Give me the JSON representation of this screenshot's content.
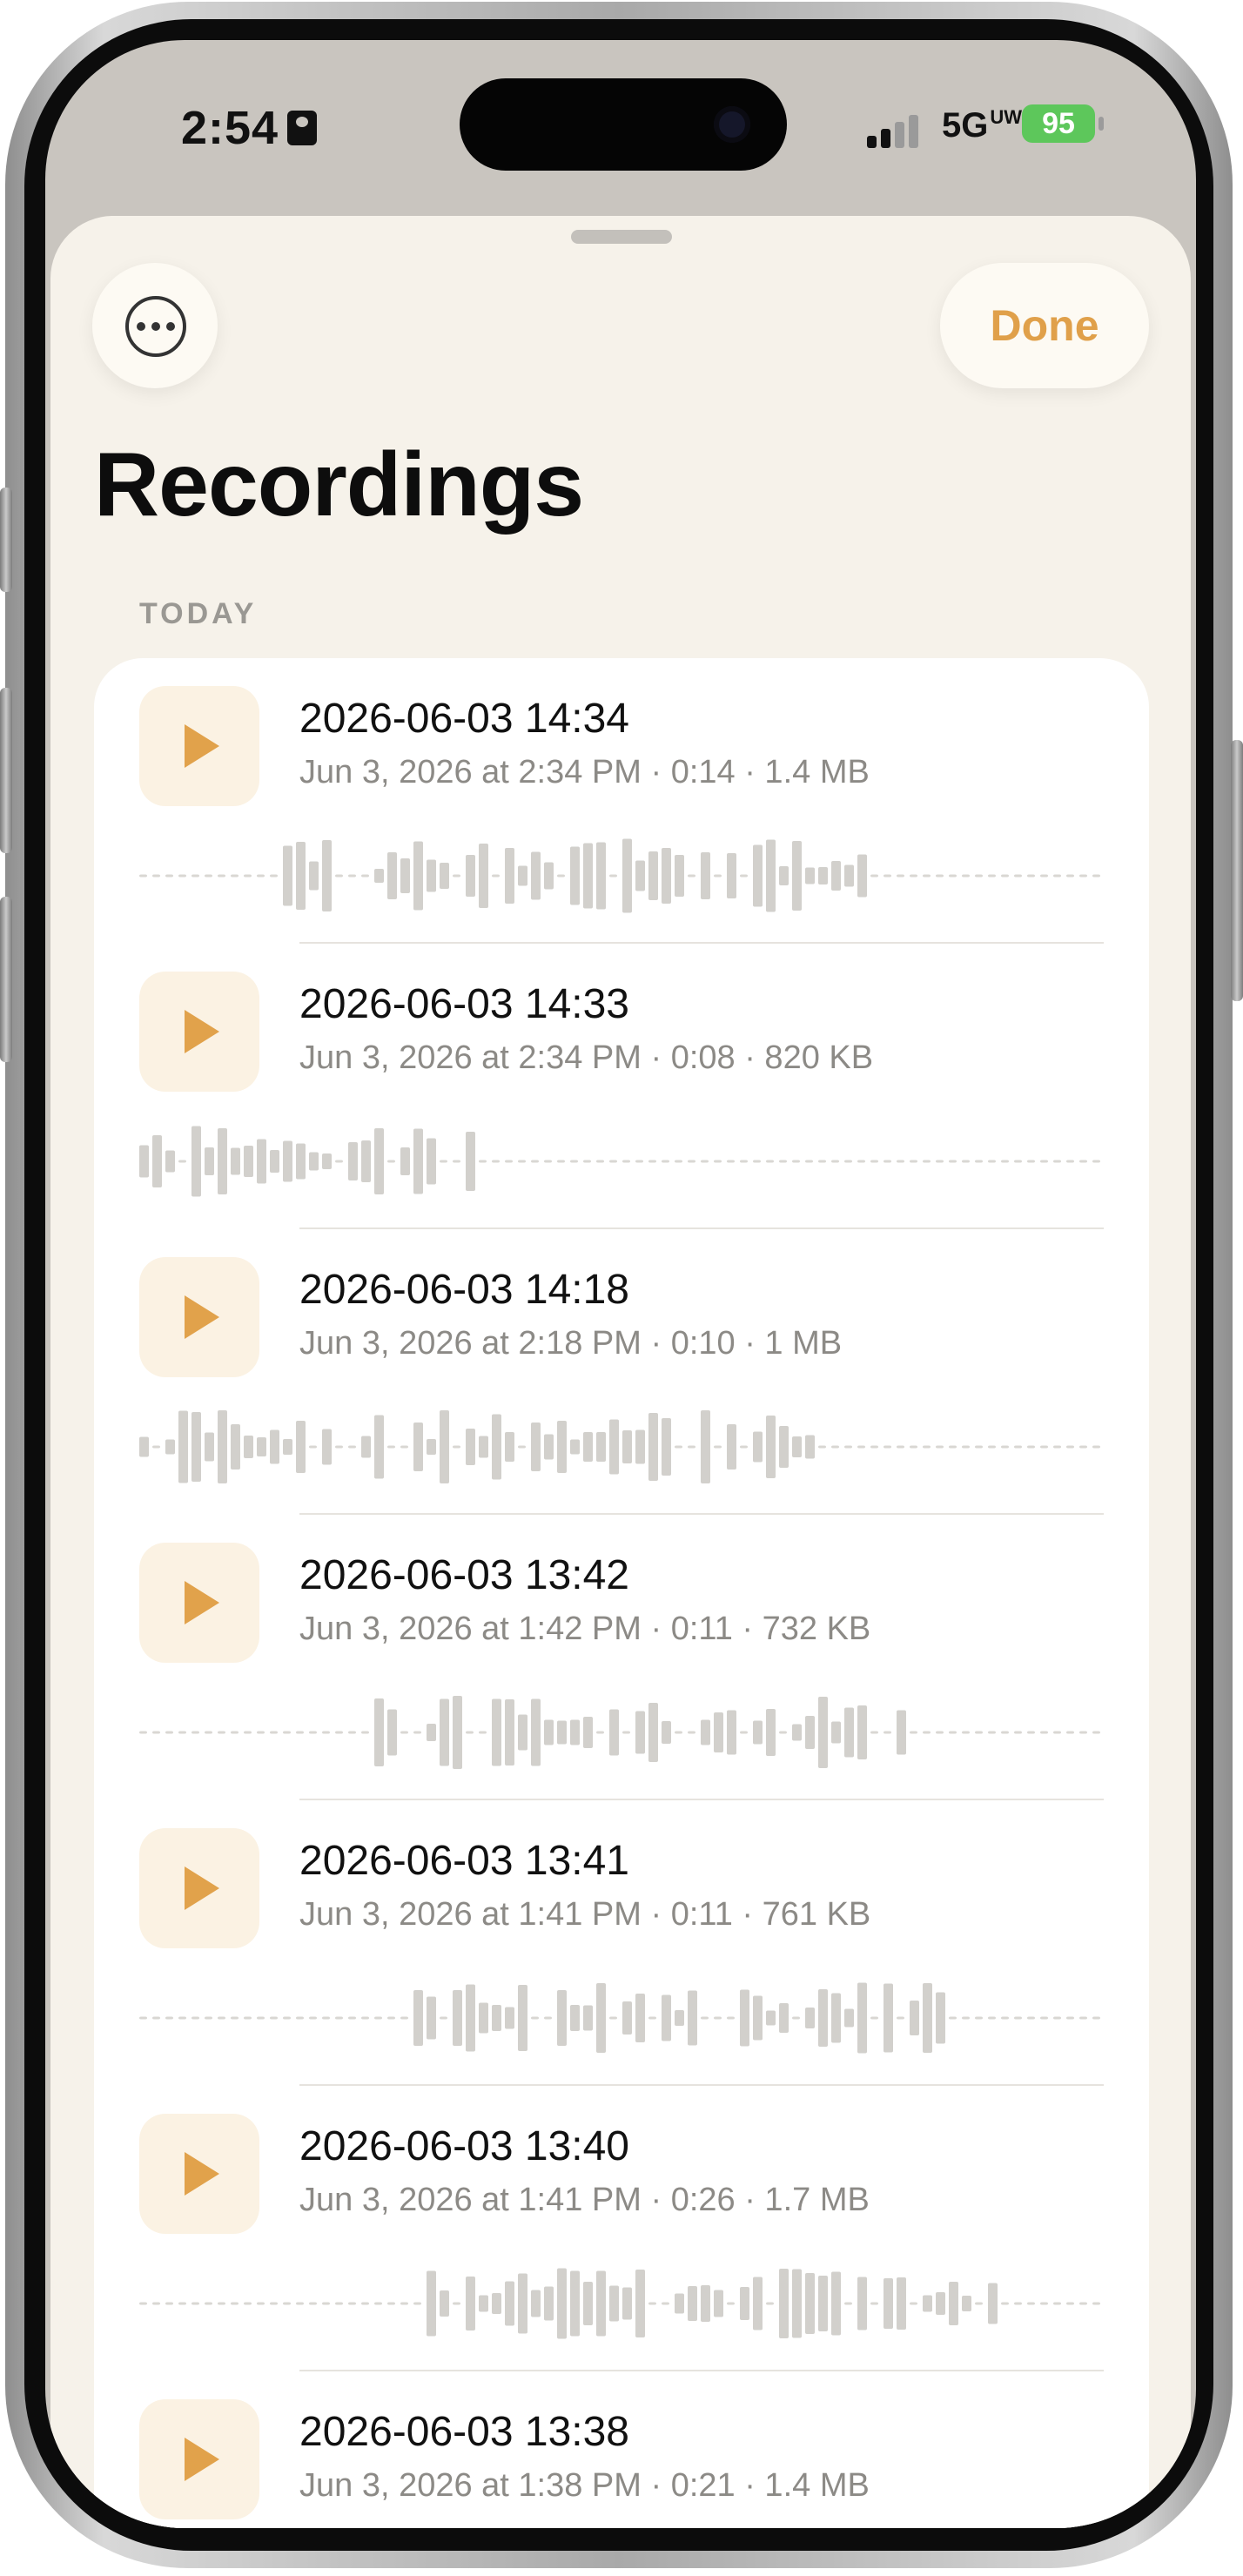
{
  "status_bar": {
    "time": "2:54",
    "network": "5G",
    "network_suffix": "UW",
    "battery": "95"
  },
  "header": {
    "done_label": "Done",
    "more_icon": "ellipsis-circle-icon",
    "title": "Recordings"
  },
  "section": {
    "label": "TODAY"
  },
  "colors": {
    "accent": "#e1a24b",
    "play_bg": "#fbf2e3",
    "sheet_bg": "#f6f2ea"
  },
  "recordings": [
    {
      "title": "2026-06-03 14:34",
      "meta": "Jun 3, 2026 at 2:34 PM  ·  0:14  ·  1.4 MB"
    },
    {
      "title": "2026-06-03 14:33",
      "meta": "Jun 3, 2026 at 2:34 PM  ·  0:08  ·  820 KB"
    },
    {
      "title": "2026-06-03 14:18",
      "meta": "Jun 3, 2026 at 2:18 PM  ·  0:10  ·  1 MB"
    },
    {
      "title": "2026-06-03 13:42",
      "meta": "Jun 3, 2026 at 1:42 PM  ·  0:11  ·  732 KB"
    },
    {
      "title": "2026-06-03 13:41",
      "meta": "Jun 3, 2026 at 1:41 PM  ·  0:11  ·  761 KB"
    },
    {
      "title": "2026-06-03 13:40",
      "meta": "Jun 3, 2026 at 1:41 PM  ·  0:26  ·  1.7 MB"
    },
    {
      "title": "2026-06-03 13:38",
      "meta": "Jun 3, 2026 at 1:38 PM  ·  0:21  ·  1.4 MB"
    }
  ]
}
